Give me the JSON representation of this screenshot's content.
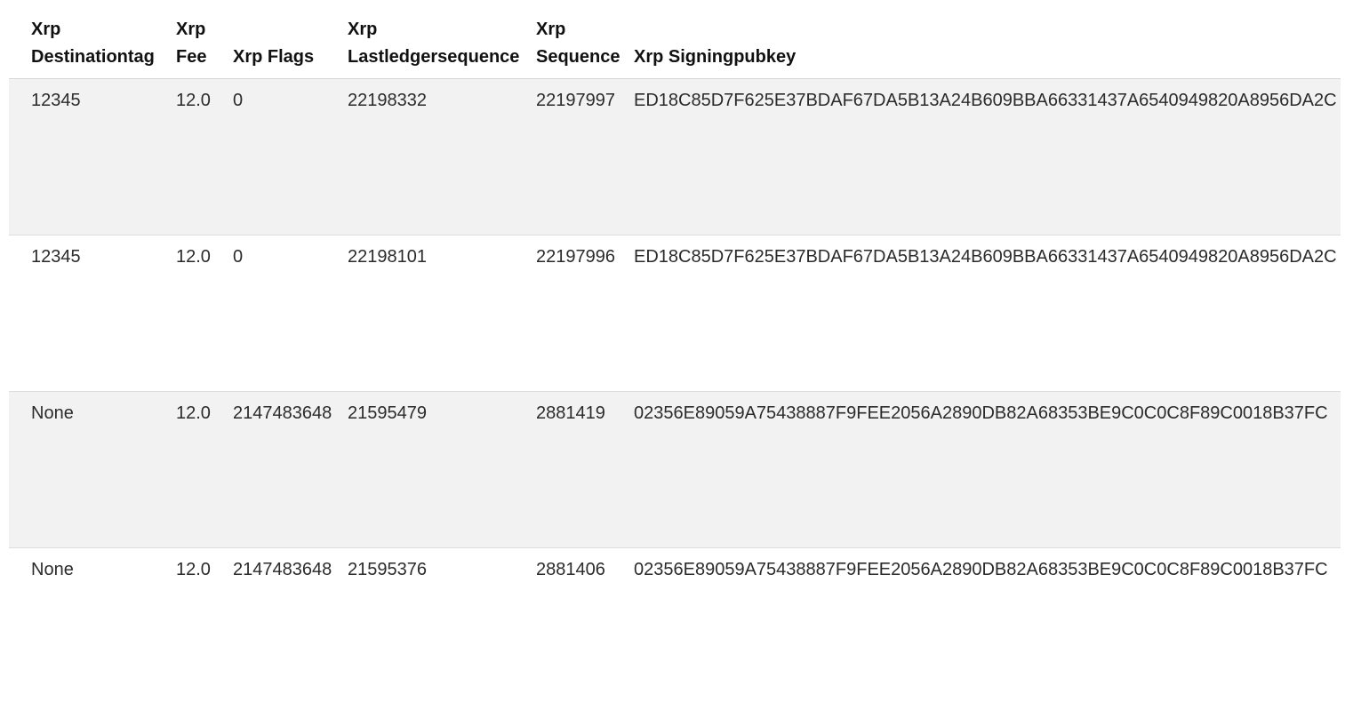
{
  "table": {
    "columns": [
      {
        "line1": "Xrp",
        "line2": "Destinationtag"
      },
      {
        "line1": "Xrp",
        "line2": "Fee"
      },
      {
        "line1": "",
        "line2": "Xrp Flags"
      },
      {
        "line1": "Xrp",
        "line2": "Lastledgersequence"
      },
      {
        "line1": "Xrp",
        "line2": "Sequence"
      },
      {
        "line1": "",
        "line2": "Xrp Signingpubkey"
      }
    ],
    "rows": [
      {
        "destinationtag": "12345",
        "fee": "12.0",
        "flags": "0",
        "lastledgersequence": "22198332",
        "sequence": "22197997",
        "signingpubkey": "ED18C85D7F625E37BDAF67DA5B13A24B609BBA66331437A6540949820A8956DA2C"
      },
      {
        "destinationtag": "12345",
        "fee": "12.0",
        "flags": "0",
        "lastledgersequence": "22198101",
        "sequence": "22197996",
        "signingpubkey": "ED18C85D7F625E37BDAF67DA5B13A24B609BBA66331437A6540949820A8956DA2C"
      },
      {
        "destinationtag": "None",
        "fee": "12.0",
        "flags": "2147483648",
        "lastledgersequence": "21595479",
        "sequence": "2881419",
        "signingpubkey": "02356E89059A75438887F9FEE2056A2890DB82A68353BE9C0C0C8F89C0018B37FC"
      },
      {
        "destinationtag": "None",
        "fee": "12.0",
        "flags": "2147483648",
        "lastledgersequence": "21595376",
        "sequence": "2881406",
        "signingpubkey": "02356E89059A75438887F9FEE2056A2890DB82A68353BE9C0C0C8F89C0018B37FC"
      }
    ]
  }
}
